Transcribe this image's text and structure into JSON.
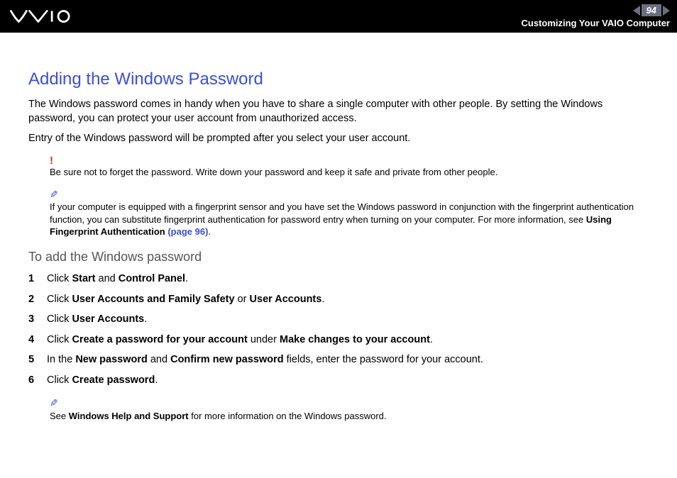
{
  "header": {
    "page_number": "94",
    "section_title": "Customizing Your VAIO Computer"
  },
  "main": {
    "title": "Adding the Windows Password",
    "para1": "The Windows password comes in handy when you have to share a single computer with other people. By setting the Windows password, you can protect your user account from unauthorized access.",
    "para2": "Entry of the Windows password will be prompted after you select your user account.",
    "warning_note": "Be sure not to forget the password. Write down your password and keep it safe and private from other people.",
    "tip_note_pre": "If your computer is equipped with a fingerprint sensor and you have set the Windows password in conjunction with the fingerprint authentication function, you can substitute fingerprint authentication for password entry when turning on your computer. For more information, see ",
    "tip_note_bold": "Using Fingerprint Authentication ",
    "tip_note_link": "(page 96)",
    "tip_note_post": ".",
    "subheading": "To add the Windows password",
    "steps": [
      {
        "num": "1",
        "pre": "Click ",
        "b1": "Start",
        "mid": " and ",
        "b2": "Control Panel",
        "post": "."
      },
      {
        "num": "2",
        "pre": "Click ",
        "b1": "User Accounts and Family Safety",
        "mid": " or ",
        "b2": "User Accounts",
        "post": "."
      },
      {
        "num": "3",
        "pre": "Click ",
        "b1": "User Accounts",
        "mid": "",
        "b2": "",
        "post": "."
      },
      {
        "num": "4",
        "pre": "Click ",
        "b1": "Create a password for your account",
        "mid": " under ",
        "b2": "Make changes to your account",
        "post": "."
      },
      {
        "num": "5",
        "pre": "In the ",
        "b1": "New password",
        "mid": " and ",
        "b2": "Confirm new password",
        "post": " fields, enter the password for your account."
      },
      {
        "num": "6",
        "pre": "Click ",
        "b1": "Create password",
        "mid": "",
        "b2": "",
        "post": "."
      }
    ],
    "footer_note_pre": "See ",
    "footer_note_bold": "Windows Help and Support",
    "footer_note_post": " for more information on the Windows password."
  }
}
